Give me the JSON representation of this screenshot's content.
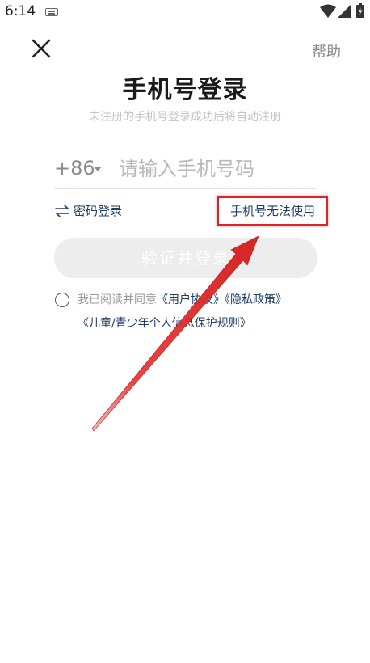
{
  "status_bar": {
    "time": "6:14",
    "icons": [
      "keyboard-icon",
      "wifi-icon",
      "signal-icon",
      "battery-icon"
    ]
  },
  "nav": {
    "close_icon": "close-icon",
    "help_label": "帮助"
  },
  "title": "手机号登录",
  "subtitle": "未注册的手机号登录成功后将自动注册",
  "phone": {
    "country_code": "+86",
    "placeholder": "请输入手机号码",
    "value": ""
  },
  "links": {
    "password_login": "密码登录",
    "phone_unavailable": "手机号无法使用"
  },
  "login_button_label": "验证并登录",
  "agreement": {
    "prefix": "我已阅读并同意",
    "user_agreement": "《用户协议》",
    "privacy_policy": "《隐私政策》",
    "children_policy": "《儿童/青少年个人信息保护规则》"
  },
  "colors": {
    "accent_text": "#1f3d68",
    "highlight_red": "#e2222a",
    "button_disabled": "#ededed"
  }
}
